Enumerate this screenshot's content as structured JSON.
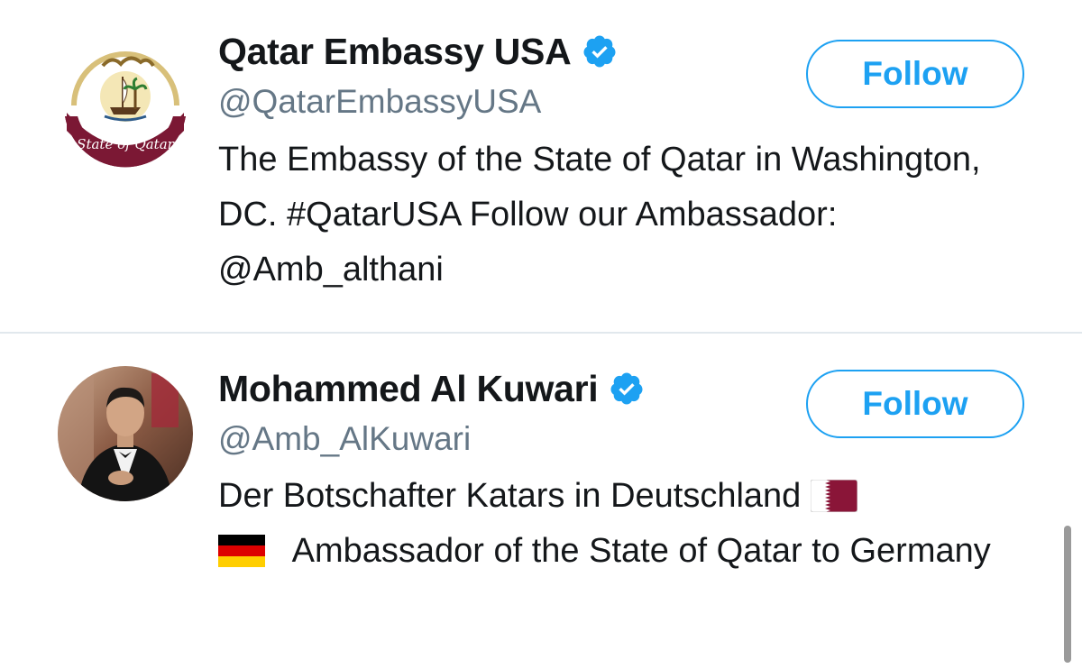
{
  "accounts": [
    {
      "display_name": "Qatar Embassy USA",
      "handle": "@QatarEmbassyUSA",
      "bio": "The Embassy of the State of Qatar in Washington, DC. #QatarUSA Follow our Ambassador: @Amb_althani",
      "follow_label": "Follow",
      "verified": true,
      "avatar": "qatar-state-emblem",
      "avatar_text": "State of Qatar"
    },
    {
      "display_name": "Mohammed Al Kuwari",
      "handle": "@Amb_AlKuwari",
      "bio_part1": "Der Botschafter Katars in Deutschland",
      "bio_part2": "Ambassador of the State of Qatar to Germany",
      "follow_label": "Follow",
      "verified": true,
      "avatar": "person-photo",
      "flags": [
        "qatar-flag",
        "germany-flag"
      ]
    }
  ],
  "colors": {
    "accent": "#1da1f2",
    "text_primary": "#14171a",
    "text_secondary": "#657786",
    "divider": "#e1e8ed",
    "qatar_maroon": "#8a1538"
  }
}
